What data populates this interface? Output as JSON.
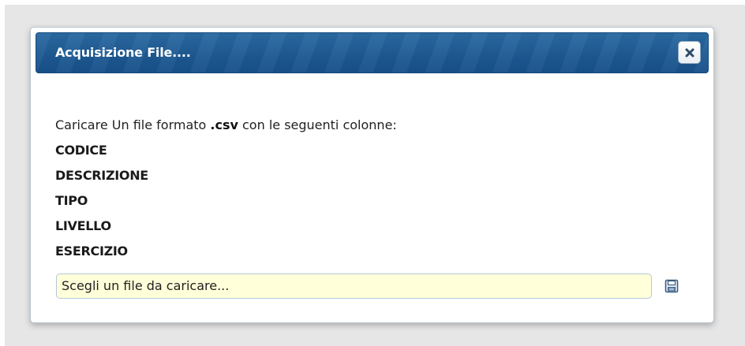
{
  "dialog": {
    "title": "Acquisizione File....",
    "close_icon": "close-icon"
  },
  "body": {
    "intro_prefix": "Caricare Un file formato ",
    "intro_format": ".csv",
    "intro_suffix": " con le seguenti colonne:",
    "columns": [
      "CODICE",
      "DESCRIZIONE",
      "TIPO",
      "LIVELLO",
      "ESERCIZIO"
    ]
  },
  "file_upload": {
    "placeholder": "Scegli un file da caricare...",
    "save_icon": "save-icon"
  },
  "colors": {
    "titlebar": "#1e5a92",
    "input_bg": "#ffffd9",
    "page_bg": "#e6e6e6"
  }
}
